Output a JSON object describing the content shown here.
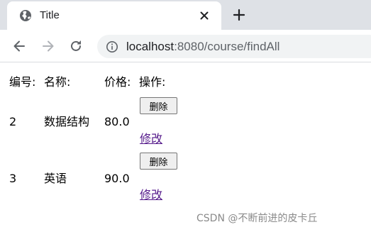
{
  "browser": {
    "tab": {
      "title": "Title",
      "close_icon": "close-icon",
      "favicon": "globe-icon"
    },
    "new_tab_icon": "plus-icon",
    "nav": {
      "back_icon": "arrow-left-icon",
      "forward_icon": "arrow-right-icon",
      "reload_icon": "reload-icon"
    },
    "address": {
      "host": "localhost",
      "rest": ":8080/course/findAll",
      "info_icon": "info-icon"
    }
  },
  "table": {
    "headers": [
      "编号:",
      "名称:",
      "价格:",
      "操作:"
    ],
    "rows": [
      {
        "id": "2",
        "name": "数据结构",
        "price": "80.0",
        "delete_label": "删除",
        "edit_label": "修改"
      },
      {
        "id": "3",
        "name": "英语",
        "price": "90.0",
        "delete_label": "删除",
        "edit_label": "修改"
      }
    ]
  },
  "watermark": "CSDN @不断前进的皮卡丘",
  "colors": {
    "tabstrip": "#dee1e6",
    "omnibox": "#f1f3f4",
    "visited_link": "#551a8b"
  }
}
